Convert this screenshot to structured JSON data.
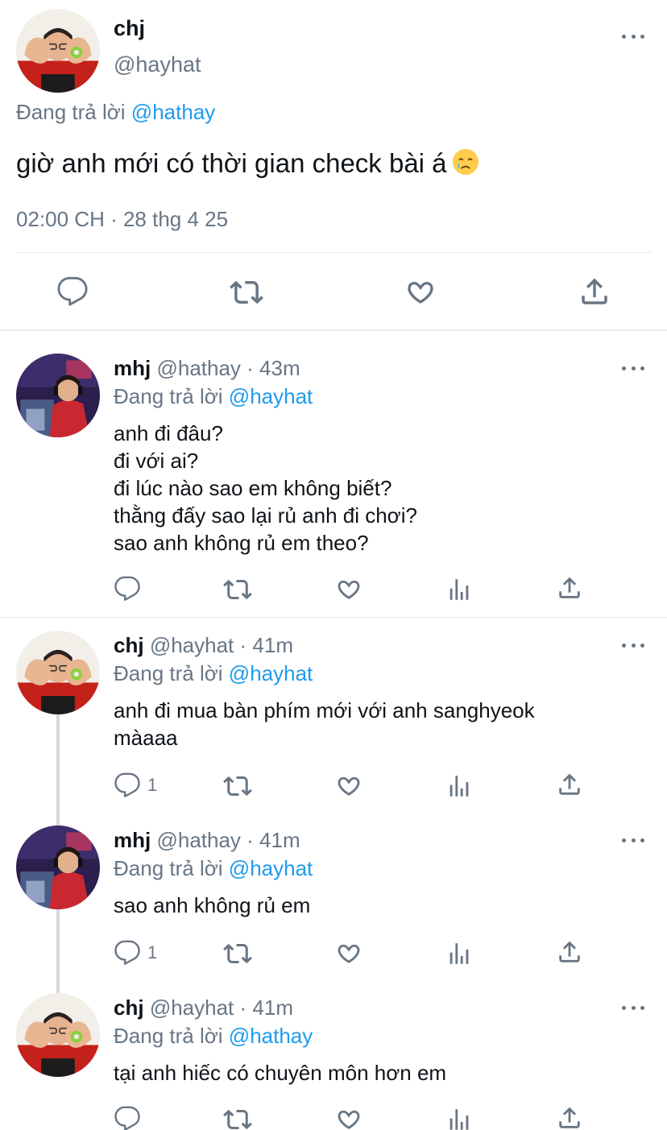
{
  "main_tweet": {
    "name": "chj",
    "handle": "@hayhat",
    "replying_prefix": "Đang trả lời",
    "replying_to": "@hathay",
    "text": "giờ anh mới có thời gian check bài á",
    "emoji": "crying-face",
    "meta": "02:00 CH · 28 thg 4 25"
  },
  "replies": [
    {
      "name": "mhj",
      "handle": "@hathay",
      "time": "· 43m",
      "replying_prefix": "Đang trả lời",
      "replying_to": "@hayhat",
      "lines": [
        "anh đi đâu?",
        "đi với ai?",
        "đi lúc nào sao em không biết?",
        "thằng đấy sao lại rủ anh đi chơi?",
        "sao anh không rủ em theo?"
      ],
      "reply_count": ""
    },
    {
      "name": "chj",
      "handle": "@hayhat",
      "time": "· 41m",
      "replying_prefix": "Đang trả lời",
      "replying_to": "@hayhat",
      "lines": [
        "anh đi mua bàn phím mới với anh sanghyeok",
        "màaaa"
      ],
      "reply_count": "1"
    },
    {
      "name": "mhj",
      "handle": "@hathay",
      "time": "· 41m",
      "replying_prefix": "Đang trả lời",
      "replying_to": "@hayhat",
      "lines": [
        "sao anh không rủ em"
      ],
      "reply_count": "1"
    },
    {
      "name": "chj",
      "handle": "@hayhat",
      "time": "· 41m",
      "replying_prefix": "Đang trả lời",
      "replying_to": "@hathay",
      "lines": [
        "tại anh hiếc có chuyên môn hơn em"
      ],
      "reply_count": ""
    }
  ],
  "colors": {
    "link": "#1d9bf0",
    "muted": "#687684",
    "text": "#0f1419",
    "divider": "#e6e9ec"
  },
  "icons": [
    "reply-icon",
    "retweet-icon",
    "like-icon",
    "analytics-icon",
    "share-icon",
    "more-icon"
  ]
}
